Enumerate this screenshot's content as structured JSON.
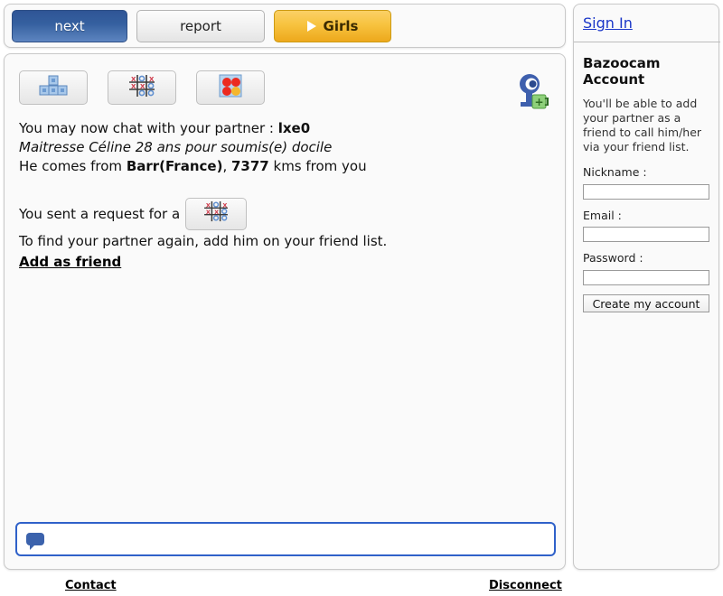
{
  "toolbar": {
    "next_label": "next",
    "report_label": "report",
    "girls_label": "Girls",
    "play_icon": "play-triangle-icon"
  },
  "games": {
    "tetris_icon": "tetris-blocks-icon",
    "tictactoe_icon": "tic-tac-toe-icon",
    "connectfour_icon": "connect-four-icon",
    "webcam_icon": "webcam-add-icon",
    "webcam_badge": "+1"
  },
  "chat": {
    "line1_prefix": "You may now chat with your partner : ",
    "partner_name": "lxe0",
    "tagline": "Maitresse Céline 28 ans pour soumis(e) docile",
    "line3_prefix": "He comes from ",
    "location": "Barr(France)",
    "line3_mid": ", ",
    "distance": "7377",
    "line3_suffix": " kms from you",
    "request_text": "You sent a request for a",
    "find_again_text": "To find your partner again, add him on your friend list.",
    "add_friend_label": "Add as friend",
    "input_value": "",
    "input_placeholder": ""
  },
  "footer": {
    "contact_label": "Contact",
    "disconnect_label": "Disconnect"
  },
  "sidebar": {
    "signin_label": "Sign In",
    "account_title": "Bazoocam Account",
    "account_desc": "You'll be able to add your partner as a friend to call him/her via your friend list.",
    "nickname_label": "Nickname :",
    "nickname_value": "",
    "email_label": "Email :",
    "email_value": "",
    "password_label": "Password :",
    "password_value": "",
    "create_button_label": "Create my account"
  },
  "colors": {
    "next_blue": "#35609f",
    "girls_gold": "#f7c33f",
    "link_blue": "#1a36c8",
    "input_focus": "#2f61c9"
  }
}
